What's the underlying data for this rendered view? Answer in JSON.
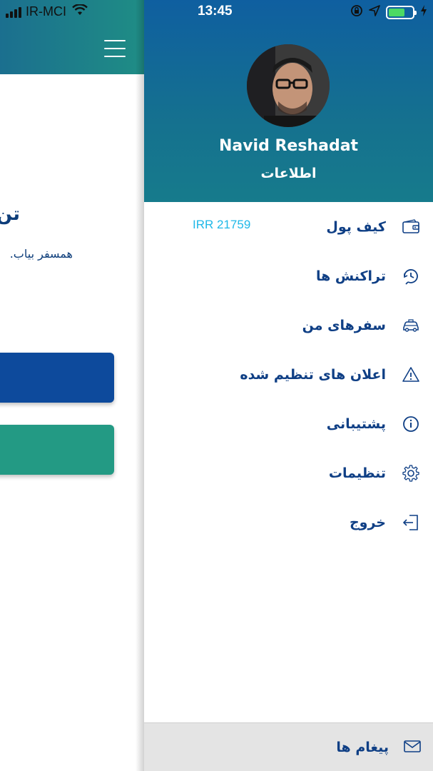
{
  "status_bar": {
    "carrier": "IR-MCI",
    "time": "13:45"
  },
  "background_screen": {
    "heading": "تن",
    "subtext": "همسفر بیاب."
  },
  "drawer": {
    "user": {
      "name": "Navid Reshadat",
      "info_link": "اطلاعات"
    },
    "menu": [
      {
        "label": "کیف پول",
        "icon": "wallet-icon",
        "value": "IRR 21759"
      },
      {
        "label": "تراکنش ها",
        "icon": "history-icon"
      },
      {
        "label": "سفرهای من",
        "icon": "taxi-icon"
      },
      {
        "label": "اعلان های تنظیم شده",
        "icon": "alert-icon"
      },
      {
        "label": "پشتیبانی",
        "icon": "info-icon"
      },
      {
        "label": "تنظیمات",
        "icon": "gear-icon"
      },
      {
        "label": "خروج",
        "icon": "logout-icon"
      }
    ],
    "footer": {
      "label": "پیغام ها",
      "icon": "mail-icon"
    }
  },
  "colors": {
    "drawer_header": "#15718f",
    "menu_text": "#0f3f85",
    "wallet_value": "#1fb8e8",
    "button_blue": "#0d4a9c",
    "button_green": "#239a84"
  }
}
